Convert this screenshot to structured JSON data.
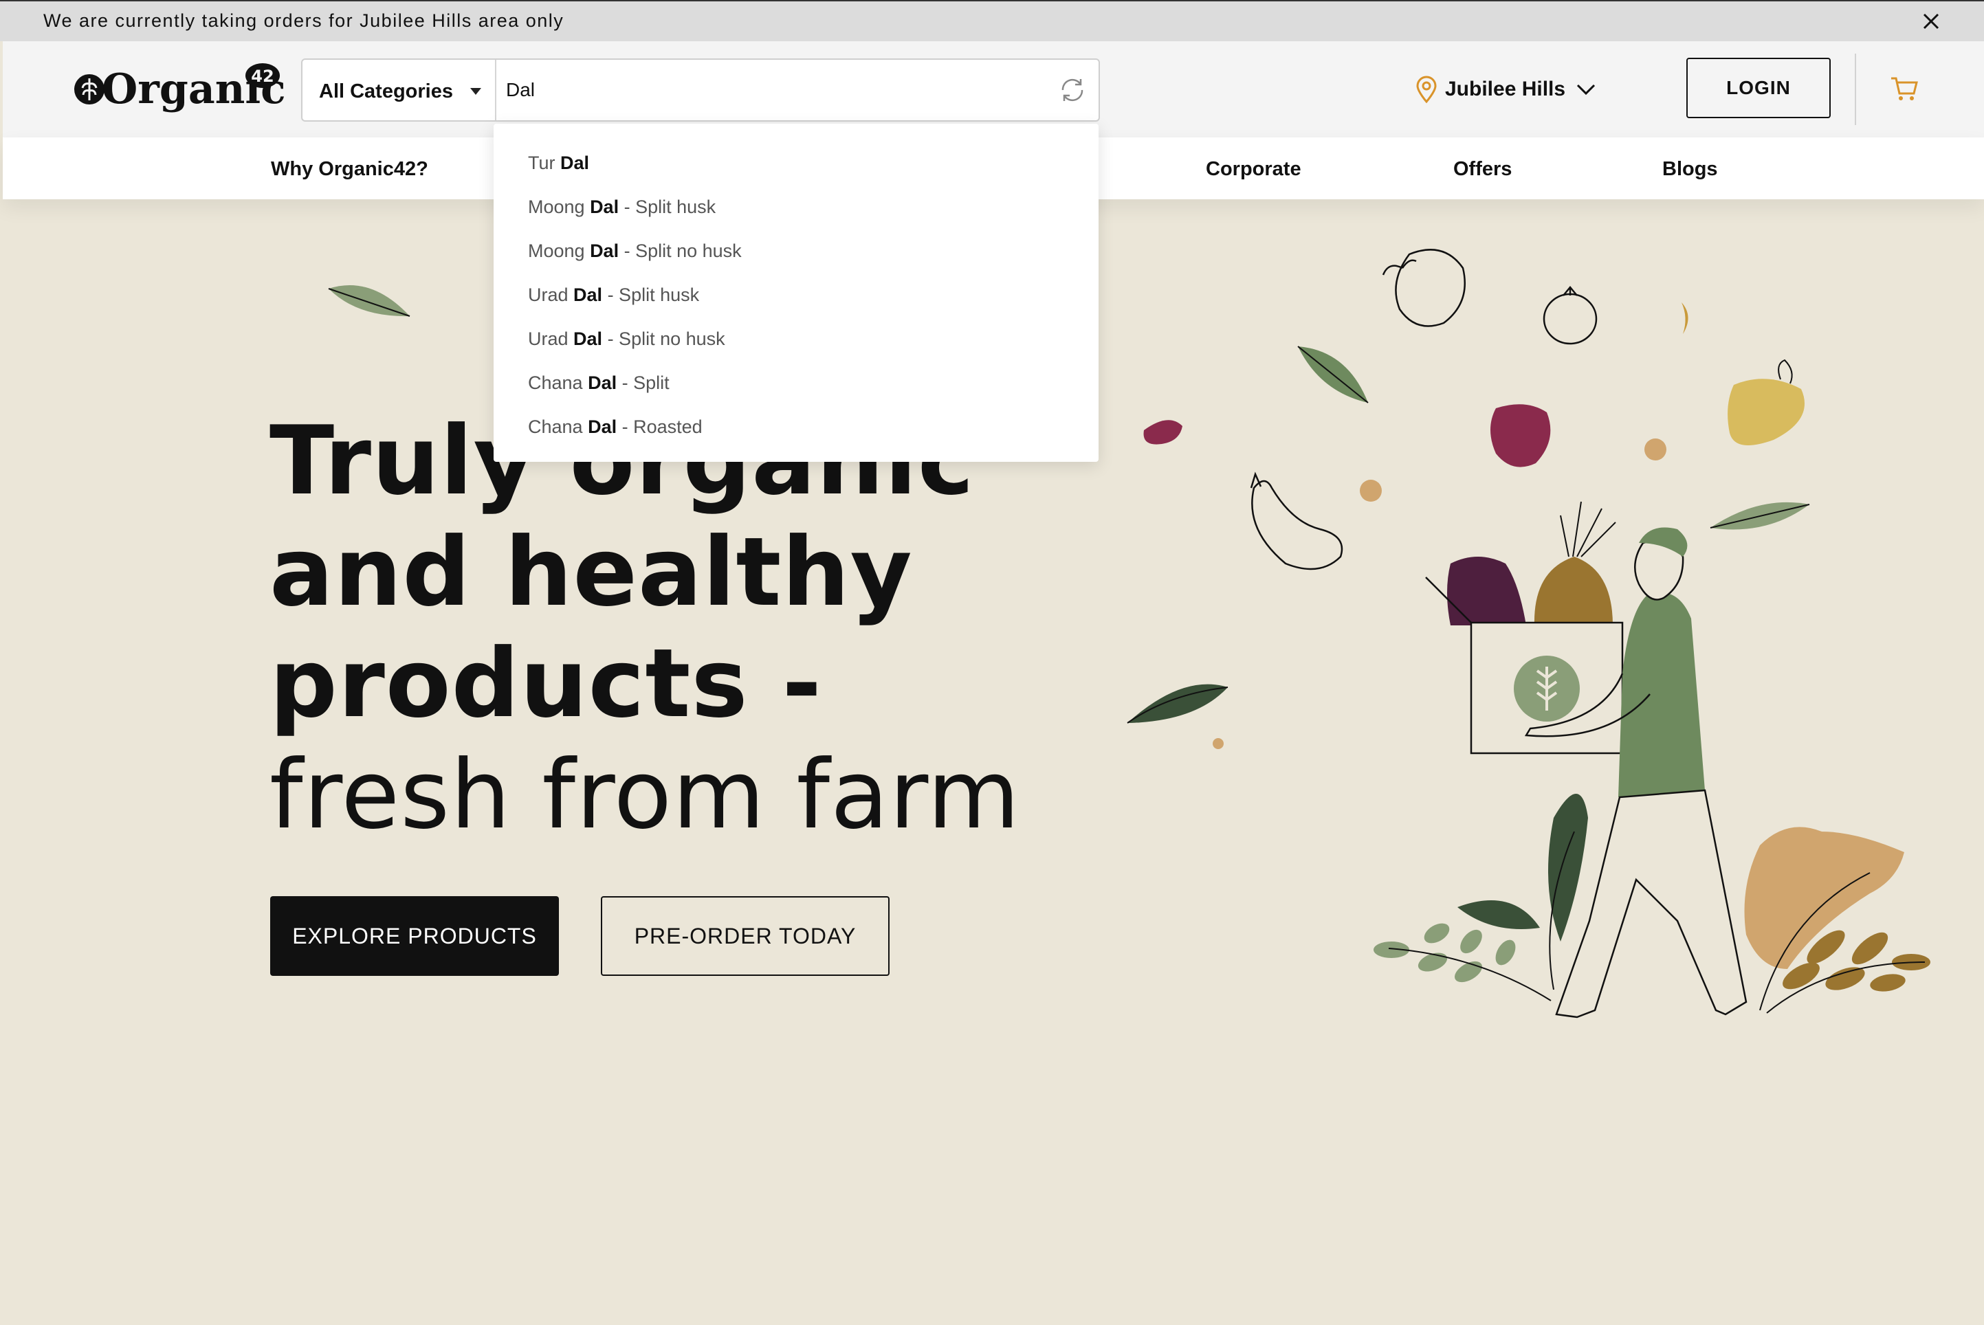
{
  "announcement": {
    "text": "We are currently taking orders for Jubilee Hills area only",
    "close_icon": "close-icon"
  },
  "header": {
    "logo_text": "Organic",
    "logo_badge": "42",
    "search": {
      "category_label": "All Categories",
      "query": "Dal",
      "refresh_icon": "refresh-icon"
    },
    "location": {
      "label": "Jubilee Hills",
      "pin_icon": "location-pin-icon",
      "chevron_icon": "chevron-down-icon"
    },
    "login_label": "LOGIN",
    "cart_icon": "cart-icon"
  },
  "nav": {
    "items": [
      "Why Organic42?",
      "Corporate",
      "Offers",
      "Blogs"
    ]
  },
  "suggestions": [
    {
      "pre": "Tur ",
      "match": "Dal",
      "post": ""
    },
    {
      "pre": "Moong ",
      "match": "Dal",
      "post": " - Split husk"
    },
    {
      "pre": "Moong ",
      "match": "Dal",
      "post": " - Split no husk"
    },
    {
      "pre": "Urad ",
      "match": "Dal",
      "post": " - Split husk"
    },
    {
      "pre": "Urad ",
      "match": "Dal",
      "post": " - Split no husk"
    },
    {
      "pre": "Chana ",
      "match": "Dal",
      "post": " - Split"
    },
    {
      "pre": "Chana ",
      "match": "Dal",
      "post": " - Roasted"
    }
  ],
  "hero": {
    "line1": "Truly organic",
    "line2": "and healthy",
    "line3": "products -",
    "line4": "fresh from farm",
    "explore_label": "EXPLORE PRODUCTS",
    "preorder_label": "PRE-ORDER TODAY"
  },
  "colors": {
    "background": "#ebe6d8",
    "accent": "#d9932a",
    "leaf_green": "#6e8a5e",
    "dark_green": "#3a5038",
    "eggplant": "#4e1f3e",
    "berry": "#8a2a4c",
    "mustard": "#d8bb5e",
    "tan": "#d0a56e"
  }
}
